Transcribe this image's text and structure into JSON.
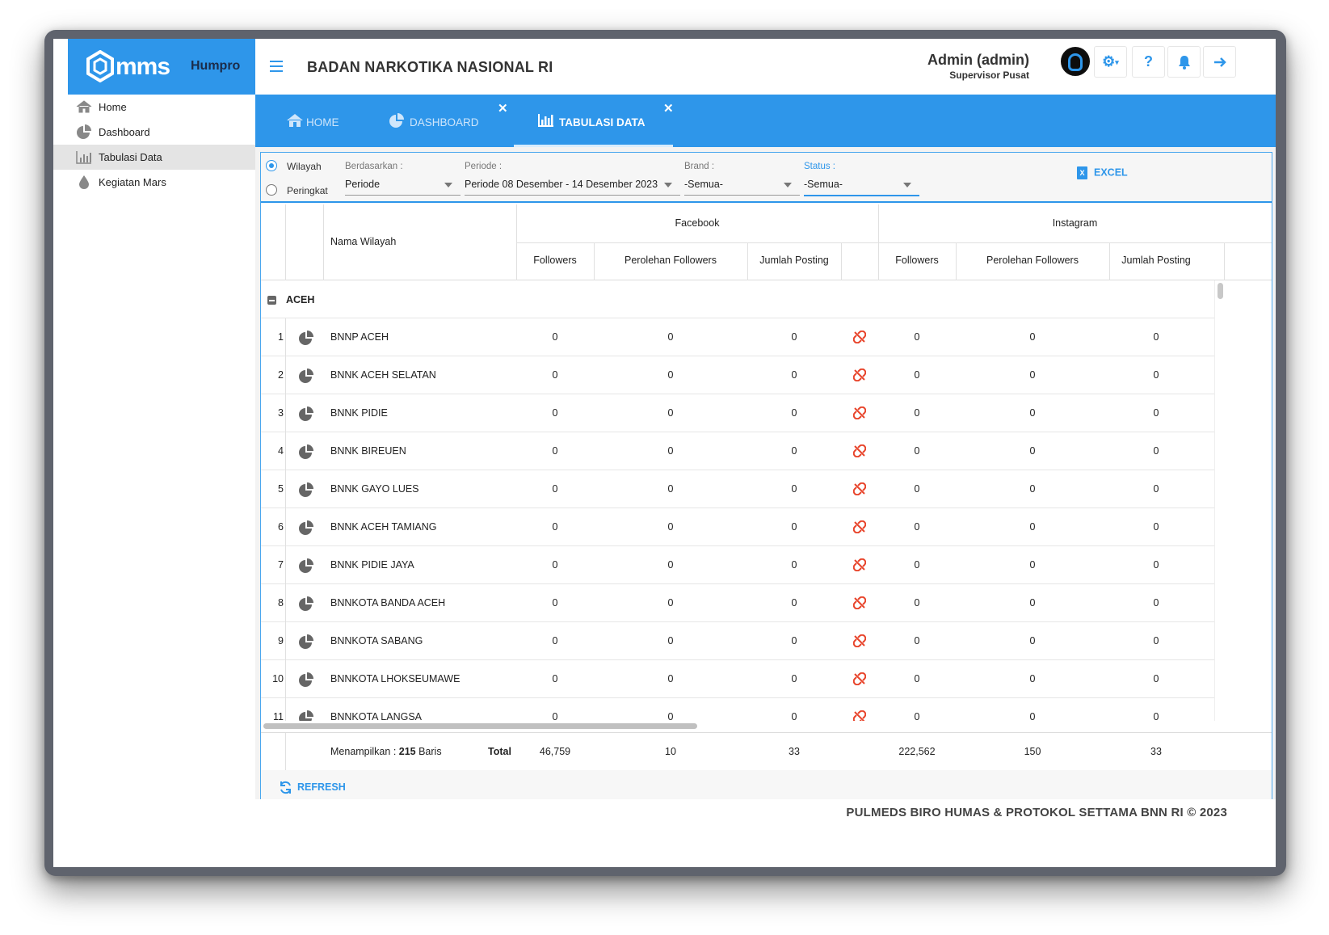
{
  "brand": {
    "logo_text": "mms",
    "module": "Humpro",
    "brand_color": "#2e96ea"
  },
  "header": {
    "title": "BADAN NARKOTIKA NASIONAL RI",
    "user_name": "Admin (admin)",
    "user_role": "Supervisor Pusat",
    "buttons": [
      "gear-icon",
      "help-icon",
      "bell-icon",
      "logout-icon"
    ]
  },
  "sidebar": {
    "items": [
      {
        "label": "Home",
        "icon": "home-icon"
      },
      {
        "label": "Dashboard",
        "icon": "pie-chart-icon"
      },
      {
        "label": "Tabulasi Data",
        "icon": "bar-chart-icon",
        "active": true
      },
      {
        "label": "Kegiatan Mars",
        "icon": "drop-icon"
      }
    ]
  },
  "tabs": [
    {
      "label": "HOME",
      "icon": "home-icon"
    },
    {
      "label": "DASHBOARD",
      "icon": "pie-chart-icon",
      "closable": true
    },
    {
      "label": "TABULASI DATA",
      "icon": "bar-chart-icon",
      "closable": true,
      "active": true
    }
  ],
  "filter": {
    "radio_wilayah": "Wilayah",
    "radio_peringkat": "Peringkat",
    "selected_radio": "Wilayah",
    "berdasarkan_label": "Berdasarkan :",
    "berdasarkan_value": "Periode",
    "periode_label": "Periode :",
    "periode_value": "Periode 08 Desember - 14 Desember 2023",
    "brand_label": "Brand :",
    "brand_value": "-Semua-",
    "status_label": "Status :",
    "status_value": "-Semua-",
    "excel_label": "EXCEL"
  },
  "table": {
    "col_name": "Nama Wilayah",
    "group_facebook": "Facebook",
    "group_instagram": "Instagram",
    "sub_followers": "Followers",
    "sub_perolehan": "Perolehan Followers",
    "sub_posting": "Jumlah Posting",
    "group_name": "ACEH",
    "rows": [
      {
        "no": "1",
        "name": "BNNP ACEH",
        "fb_followers": "0",
        "fb_perolehan": "0",
        "fb_posting": "0",
        "ig_followers": "0",
        "ig_perolehan": "0",
        "ig_posting": "0"
      },
      {
        "no": "2",
        "name": "BNNK ACEH SELATAN",
        "fb_followers": "0",
        "fb_perolehan": "0",
        "fb_posting": "0",
        "ig_followers": "0",
        "ig_perolehan": "0",
        "ig_posting": "0"
      },
      {
        "no": "3",
        "name": "BNNK PIDIE",
        "fb_followers": "0",
        "fb_perolehan": "0",
        "fb_posting": "0",
        "ig_followers": "0",
        "ig_perolehan": "0",
        "ig_posting": "0"
      },
      {
        "no": "4",
        "name": "BNNK BIREUEN",
        "fb_followers": "0",
        "fb_perolehan": "0",
        "fb_posting": "0",
        "ig_followers": "0",
        "ig_perolehan": "0",
        "ig_posting": "0"
      },
      {
        "no": "5",
        "name": "BNNK GAYO LUES",
        "fb_followers": "0",
        "fb_perolehan": "0",
        "fb_posting": "0",
        "ig_followers": "0",
        "ig_perolehan": "0",
        "ig_posting": "0"
      },
      {
        "no": "6",
        "name": "BNNK ACEH TAMIANG",
        "fb_followers": "0",
        "fb_perolehan": "0",
        "fb_posting": "0",
        "ig_followers": "0",
        "ig_perolehan": "0",
        "ig_posting": "0"
      },
      {
        "no": "7",
        "name": "BNNK PIDIE JAYA",
        "fb_followers": "0",
        "fb_perolehan": "0",
        "fb_posting": "0",
        "ig_followers": "0",
        "ig_perolehan": "0",
        "ig_posting": "0"
      },
      {
        "no": "8",
        "name": "BNNKOTA BANDA ACEH",
        "fb_followers": "0",
        "fb_perolehan": "0",
        "fb_posting": "0",
        "ig_followers": "0",
        "ig_perolehan": "0",
        "ig_posting": "0"
      },
      {
        "no": "9",
        "name": "BNNKOTA SABANG",
        "fb_followers": "0",
        "fb_perolehan": "0",
        "fb_posting": "0",
        "ig_followers": "0",
        "ig_perolehan": "0",
        "ig_posting": "0"
      },
      {
        "no": "10",
        "name": "BNNKOTA LHOKSEUMAWE",
        "fb_followers": "0",
        "fb_perolehan": "0",
        "fb_posting": "0",
        "ig_followers": "0",
        "ig_perolehan": "0",
        "ig_posting": "0"
      },
      {
        "no": "11",
        "name": "BNNKOTA LANGSA",
        "fb_followers": "0",
        "fb_perolehan": "0",
        "fb_posting": "0",
        "ig_followers": "0",
        "ig_perolehan": "0",
        "ig_posting": "0"
      }
    ],
    "footer": {
      "showing_prefix": "Menampilkan : ",
      "showing_count": "215",
      "showing_suffix": " Baris",
      "total_label": "Total",
      "fb_followers": "46,759",
      "fb_perolehan": "10",
      "fb_posting": "33",
      "ig_followers": "222,562",
      "ig_perolehan": "150",
      "ig_posting": "33"
    }
  },
  "refresh_label": "REFRESH",
  "copyright": "PULMEDS BIRO HUMAS & PROTOKOL SETTAMA BNN RI © 2023"
}
